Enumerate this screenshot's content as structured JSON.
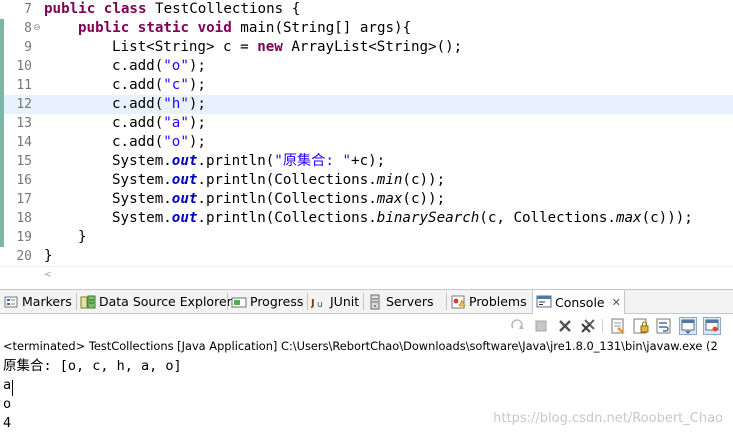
{
  "editor": {
    "lines": [
      {
        "num": "7",
        "fold": "",
        "changed": false,
        "current": false,
        "indent": 0,
        "tokens": [
          {
            "t": "public",
            "c": "kw"
          },
          {
            "t": " "
          },
          {
            "t": "class",
            "c": "kw"
          },
          {
            "t": " TestCollections {"
          }
        ]
      },
      {
        "num": "8",
        "fold": "⊖",
        "changed": true,
        "current": false,
        "indent": 4,
        "tokens": [
          {
            "t": "public",
            "c": "kw"
          },
          {
            "t": " "
          },
          {
            "t": "static",
            "c": "kw"
          },
          {
            "t": " "
          },
          {
            "t": "void",
            "c": "kw"
          },
          {
            "t": " main(String[] args){"
          }
        ]
      },
      {
        "num": "9",
        "fold": "",
        "changed": true,
        "current": false,
        "indent": 8,
        "tokens": [
          {
            "t": "List<String> c = "
          },
          {
            "t": "new",
            "c": "kw"
          },
          {
            "t": " ArrayList<String>();"
          }
        ]
      },
      {
        "num": "10",
        "fold": "",
        "changed": true,
        "current": false,
        "indent": 8,
        "tokens": [
          {
            "t": "c.add("
          },
          {
            "t": "\"o\"",
            "c": "str"
          },
          {
            "t": ");"
          }
        ]
      },
      {
        "num": "11",
        "fold": "",
        "changed": true,
        "current": false,
        "indent": 8,
        "tokens": [
          {
            "t": "c.add("
          },
          {
            "t": "\"c\"",
            "c": "str"
          },
          {
            "t": ");"
          }
        ]
      },
      {
        "num": "12",
        "fold": "",
        "changed": true,
        "current": true,
        "indent": 8,
        "tokens": [
          {
            "t": "c.add("
          },
          {
            "t": "\"h\"",
            "c": "str"
          },
          {
            "t": ");"
          }
        ]
      },
      {
        "num": "13",
        "fold": "",
        "changed": true,
        "current": false,
        "indent": 8,
        "tokens": [
          {
            "t": "c.add("
          },
          {
            "t": "\"a\"",
            "c": "str"
          },
          {
            "t": ");"
          }
        ]
      },
      {
        "num": "14",
        "fold": "",
        "changed": true,
        "current": false,
        "indent": 8,
        "tokens": [
          {
            "t": "c.add("
          },
          {
            "t": "\"o\"",
            "c": "str"
          },
          {
            "t": ");"
          }
        ]
      },
      {
        "num": "15",
        "fold": "",
        "changed": true,
        "current": false,
        "indent": 8,
        "tokens": [
          {
            "t": "System."
          },
          {
            "t": "out",
            "c": "fld"
          },
          {
            "t": ".println("
          },
          {
            "t": "\"原集合: \"",
            "c": "str"
          },
          {
            "t": "+c);"
          }
        ]
      },
      {
        "num": "16",
        "fold": "",
        "changed": true,
        "current": false,
        "indent": 8,
        "tokens": [
          {
            "t": "System."
          },
          {
            "t": "out",
            "c": "fld"
          },
          {
            "t": ".println(Collections."
          },
          {
            "t": "min",
            "c": "itl"
          },
          {
            "t": "(c));"
          }
        ]
      },
      {
        "num": "17",
        "fold": "",
        "changed": true,
        "current": false,
        "indent": 8,
        "tokens": [
          {
            "t": "System."
          },
          {
            "t": "out",
            "c": "fld"
          },
          {
            "t": ".println(Collections."
          },
          {
            "t": "max",
            "c": "itl"
          },
          {
            "t": "(c));"
          }
        ]
      },
      {
        "num": "18",
        "fold": "",
        "changed": true,
        "current": false,
        "indent": 8,
        "tokens": [
          {
            "t": "System."
          },
          {
            "t": "out",
            "c": "fld"
          },
          {
            "t": ".println(Collections."
          },
          {
            "t": "binarySearch",
            "c": "itl"
          },
          {
            "t": "(c, Collections."
          },
          {
            "t": "max",
            "c": "itl"
          },
          {
            "t": "(c)));"
          }
        ]
      },
      {
        "num": "19",
        "fold": "",
        "changed": true,
        "current": false,
        "indent": 4,
        "tokens": [
          {
            "t": "}"
          }
        ]
      },
      {
        "num": "20",
        "fold": "",
        "changed": false,
        "current": false,
        "indent": 0,
        "tokens": [
          {
            "t": "}"
          }
        ]
      }
    ],
    "scroll_arrow": "<"
  },
  "tabs": [
    {
      "label": "Markers",
      "icon": "markers-icon",
      "active": false
    },
    {
      "label": "Data Source Explorer",
      "icon": "data-source-explorer-icon",
      "active": false
    },
    {
      "label": "Progress",
      "icon": "progress-icon",
      "active": false
    },
    {
      "label": "JUnit",
      "icon": "junit-icon",
      "icon_text": "Ju",
      "active": false
    },
    {
      "label": "Servers",
      "icon": "servers-icon",
      "active": false
    },
    {
      "label": "Problems",
      "icon": "problems-icon",
      "active": false
    },
    {
      "label": "Console",
      "icon": "console-icon",
      "active": true,
      "close": "✕"
    }
  ],
  "toolbar_buttons": [
    "terminate-relaunch-icon",
    "stop-icon",
    "remove-launch-icon",
    "remove-all-terminated-icon",
    "clear-console-icon",
    "scroll-lock-icon",
    "word-wrap-icon",
    "show-when-output-icon",
    "pin-console-icon"
  ],
  "console": {
    "header": "<terminated> TestCollections [Java Application] C:\\Users\\RebortChao\\Downloads\\software\\Java\\jre1.8.0_131\\bin\\javaw.exe (2",
    "output": [
      "原集合: [o, c, h, a, o]",
      "a",
      "o",
      "4"
    ]
  },
  "watermark": "https://blog.csdn.net/Roobert_Chao",
  "colors": {
    "keyword": "#7f0055",
    "string": "#2a00ff",
    "static_field": "#0000c0",
    "current_line": "#e8f2fe",
    "change_bar": "#7fb5a7"
  }
}
